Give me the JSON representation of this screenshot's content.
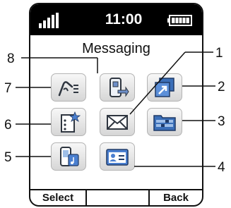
{
  "status": {
    "time": "11:00"
  },
  "title": "Messaging",
  "softkeys": {
    "left": "Select",
    "middle": "",
    "right": "Back"
  },
  "tiles": [
    {
      "id": "voice-mail",
      "icon": "voicemail-icon"
    },
    {
      "id": "templates",
      "icon": "sim-templates-icon"
    },
    {
      "id": "outbox",
      "icon": "outbox-arrow-icon"
    },
    {
      "id": "favorites",
      "icon": "starred-list-icon"
    },
    {
      "id": "inbox",
      "icon": "envelope-icon"
    },
    {
      "id": "folders",
      "icon": "folders-icon"
    },
    {
      "id": "phone-sms",
      "icon": "phone-music-icon"
    },
    {
      "id": "contact-card",
      "icon": "contact-card-icon"
    }
  ],
  "callouts": [
    "1",
    "2",
    "3",
    "4",
    "5",
    "6",
    "7",
    "8"
  ]
}
